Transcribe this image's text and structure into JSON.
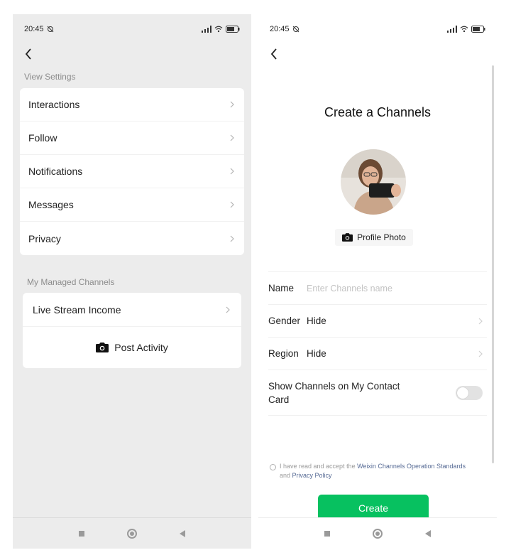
{
  "left": {
    "status": {
      "time": "20:45"
    },
    "view_settings_label": "View Settings",
    "settings_items": [
      {
        "label": "Interactions"
      },
      {
        "label": "Follow"
      },
      {
        "label": "Notifications"
      },
      {
        "label": "Messages"
      },
      {
        "label": "Privacy"
      }
    ],
    "managed_label": "My Managed Channels",
    "live_stream_income": "Live Stream Income",
    "post_activity": "Post Activity"
  },
  "right": {
    "status": {
      "time": "20:45"
    },
    "title": "Create a Channels",
    "profile_photo_label": "Profile Photo",
    "name_label": "Name",
    "name_placeholder": "Enter Channels name",
    "gender_label": "Gender",
    "gender_value": "Hide",
    "region_label": "Region",
    "region_value": "Hide",
    "show_on_card_label": "Show Channels on My Contact Card",
    "show_on_card_enabled": false,
    "agree_prefix": "I have read and accept the ",
    "agree_link1": "Weixin Channels Operation Standards",
    "agree_and": " and ",
    "agree_link2": "Privacy Policy",
    "create_label": "Create"
  },
  "colors": {
    "accent_green": "#07c160",
    "link_blue": "#576b95",
    "left_bg": "#ececec"
  },
  "icons": [
    "back-arrow-icon",
    "chevron-right-icon",
    "camera-icon",
    "signal-icon",
    "wifi-icon",
    "battery-icon",
    "alarm-off-icon"
  ]
}
